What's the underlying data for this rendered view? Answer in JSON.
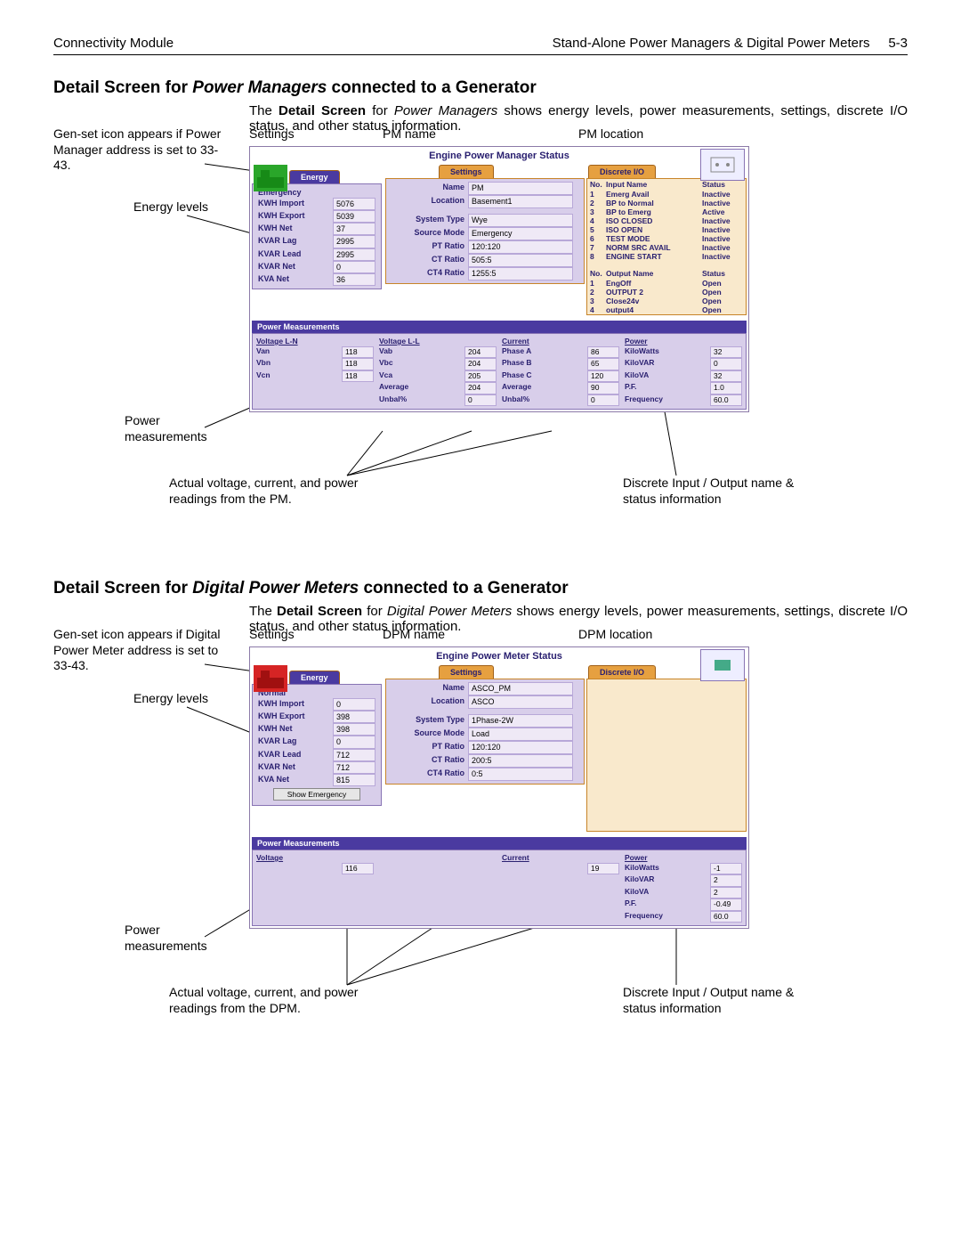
{
  "header": {
    "left": "Connectivity Module",
    "right": "Stand-Alone Power Managers & Digital Power Meters",
    "page": "5-3"
  },
  "section1": {
    "title_pre": "Detail Screen for ",
    "title_ital": "Power Managers",
    "title_post": " connected to a Generator",
    "intro_a": "The ",
    "intro_b": "Detail Screen",
    "intro_c": " for ",
    "intro_d": "Power Managers",
    "intro_e": " shows energy levels, power measurements, settings, discrete I/O status, and other status information."
  },
  "ann1": {
    "genset": "Gen-set icon appears if Power Manager address is set to 33-43.",
    "settings": "Settings",
    "pmname": "PM name",
    "pmloc": "PM location",
    "energy": "Energy levels",
    "power": "Power measurements",
    "actual": "Actual voltage, current, and power readings from the PM.",
    "discrete": "Discrete Input / Output name & status information"
  },
  "app1": {
    "title": "Engine Power Manager Status",
    "tabs": {
      "energy": "Energy",
      "settings": "Settings",
      "discrete": "Discrete I/O"
    },
    "status_line": "Emergency",
    "energy": [
      {
        "l": "KWH Import",
        "v": "5076"
      },
      {
        "l": "KWH Export",
        "v": "5039"
      },
      {
        "l": "KWH Net",
        "v": "37"
      },
      {
        "l": "KVAR Lag",
        "v": "2995"
      },
      {
        "l": "KVAR Lead",
        "v": "2995"
      },
      {
        "l": "KVAR Net",
        "v": "0"
      },
      {
        "l": "KVA Net",
        "v": "36"
      }
    ],
    "settings": [
      {
        "l": "Name",
        "v": "PM"
      },
      {
        "l": "Location",
        "v": "Basement1"
      },
      {
        "l": "System Type",
        "v": "Wye"
      },
      {
        "l": "Source Mode",
        "v": "Emergency"
      },
      {
        "l": "PT Ratio",
        "v": "120:120"
      },
      {
        "l": "CT Ratio",
        "v": "505:5"
      },
      {
        "l": "CT4 Ratio",
        "v": "1255:5"
      }
    ],
    "inputs_hdr": {
      "no": "No.",
      "name": "Input Name",
      "status": "Status"
    },
    "inputs": [
      {
        "n": "1",
        "name": "Emerg Avail",
        "s": "Inactive"
      },
      {
        "n": "2",
        "name": "BP to Normal",
        "s": "Inactive"
      },
      {
        "n": "3",
        "name": "BP to Emerg",
        "s": "Active"
      },
      {
        "n": "4",
        "name": "ISO CLOSED",
        "s": "Inactive"
      },
      {
        "n": "5",
        "name": "ISO OPEN",
        "s": "Inactive"
      },
      {
        "n": "6",
        "name": "TEST MODE",
        "s": "Inactive"
      },
      {
        "n": "7",
        "name": "NORM SRC AVAIL",
        "s": "Inactive"
      },
      {
        "n": "8",
        "name": "ENGINE START",
        "s": "Inactive"
      }
    ],
    "outputs_hdr": {
      "no": "No.",
      "name": "Output Name",
      "status": "Status"
    },
    "outputs": [
      {
        "n": "1",
        "name": "EngOff",
        "s": "Open"
      },
      {
        "n": "2",
        "name": "OUTPUT 2",
        "s": "Open"
      },
      {
        "n": "3",
        "name": "Close24v",
        "s": "Open"
      },
      {
        "n": "4",
        "name": "output4",
        "s": "Open"
      }
    ],
    "pm_title": "Power Measurements",
    "pm": {
      "c1": {
        "h": "Voltage L-N",
        "r": [
          [
            "Van",
            "118"
          ],
          [
            "Vbn",
            "118"
          ],
          [
            "Vcn",
            "118"
          ]
        ]
      },
      "c2": {
        "h": "Voltage L-L",
        "r": [
          [
            "Vab",
            "204"
          ],
          [
            "Vbc",
            "204"
          ],
          [
            "Vca",
            "205"
          ],
          [
            "Average",
            "204"
          ],
          [
            "Unbal%",
            "0"
          ]
        ]
      },
      "c3": {
        "h": "Current",
        "r": [
          [
            "Phase A",
            "86"
          ],
          [
            "Phase B",
            "65"
          ],
          [
            "Phase C",
            "120"
          ],
          [
            "Average",
            "90"
          ],
          [
            "Unbal%",
            "0"
          ]
        ]
      },
      "c4": {
        "h": "Power",
        "r": [
          [
            "KiloWatts",
            "32"
          ],
          [
            "KiloVAR",
            "0"
          ],
          [
            "KiloVA",
            "32"
          ],
          [
            "P.F.",
            "1.0"
          ],
          [
            "Frequency",
            "60.0"
          ]
        ]
      }
    }
  },
  "section2": {
    "title_pre": "Detail Screen for ",
    "title_ital": "Digital Power Meters",
    "title_post": " connected to a Generator",
    "intro_a": "The ",
    "intro_b": "Detail Screen",
    "intro_c": " for ",
    "intro_d": "Digital Power Meters",
    "intro_e": " shows energy levels, power measurements, settings, discrete I/O status, and other status information."
  },
  "ann2": {
    "genset": "Gen-set icon appears if Digital Power Meter address is set to 33-43.",
    "settings": "Settings",
    "pmname": "DPM name",
    "pmloc": "DPM location",
    "energy": "Energy levels",
    "power": "Power measurements",
    "actual": "Actual voltage, current, and power readings from the DPM.",
    "discrete": "Discrete Input / Output name & status information"
  },
  "app2": {
    "title": "Engine Power Meter Status",
    "tabs": {
      "energy": "Energy",
      "settings": "Settings",
      "discrete": "Discrete I/O"
    },
    "status_line": "Normal",
    "show_btn": "Show Emergency",
    "energy": [
      {
        "l": "KWH Import",
        "v": "0"
      },
      {
        "l": "KWH Export",
        "v": "398"
      },
      {
        "l": "KWH Net",
        "v": "398"
      },
      {
        "l": "KVAR Lag",
        "v": "0"
      },
      {
        "l": "KVAR Lead",
        "v": "712"
      },
      {
        "l": "KVAR Net",
        "v": "712"
      },
      {
        "l": "KVA Net",
        "v": "815"
      }
    ],
    "settings": [
      {
        "l": "Name",
        "v": "ASCO_PM"
      },
      {
        "l": "Location",
        "v": "ASCO"
      },
      {
        "l": "System Type",
        "v": "1Phase-2W"
      },
      {
        "l": "Source Mode",
        "v": "Load"
      },
      {
        "l": "PT Ratio",
        "v": "120:120"
      },
      {
        "l": "CT Ratio",
        "v": "200:5"
      },
      {
        "l": "CT4 Ratio",
        "v": "0:5"
      }
    ],
    "pm_title": "Power Measurements",
    "pm": {
      "c1": {
        "h": "Voltage",
        "r": [
          [
            "",
            "116"
          ]
        ]
      },
      "c3": {
        "h": "Current",
        "r": [
          [
            "",
            "19"
          ]
        ]
      },
      "c4": {
        "h": "Power",
        "r": [
          [
            "KiloWatts",
            "-1"
          ],
          [
            "KiloVAR",
            "2"
          ],
          [
            "KiloVA",
            "2"
          ],
          [
            "P.F.",
            "-0.49"
          ],
          [
            "Frequency",
            "60.0"
          ]
        ]
      }
    }
  }
}
